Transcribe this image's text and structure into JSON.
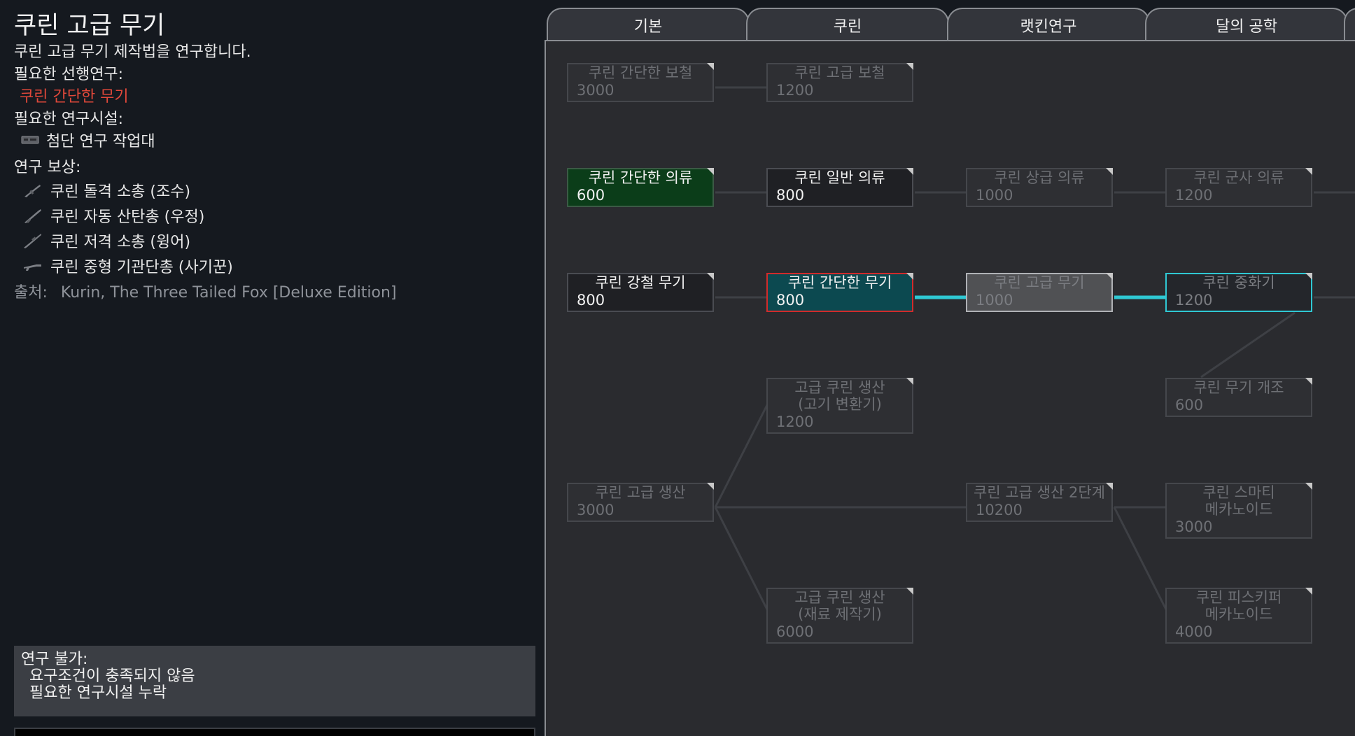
{
  "left_panel": {
    "title": "쿠린 고급 무기",
    "description": "쿠린 고급 무기 제작법을 연구합니다.",
    "prerequisites_label": "필요한 선행연구:",
    "prerequisite": "쿠린 간단한 무기",
    "bench_label": "필요한 연구시설:",
    "bench": "첨단 연구 작업대",
    "rewards_label": "연구 보상:",
    "rewards": [
      {
        "name": "쿠린 돌격 소총 (조수)",
        "icon": "rifle-icon"
      },
      {
        "name": "쿠린 자동 산탄총 (우정)",
        "icon": "shotgun-icon"
      },
      {
        "name": "쿠린 저격 소총 (윙어)",
        "icon": "sniper-icon"
      },
      {
        "name": "쿠린 중형 기관단총 (사기꾼)",
        "icon": "smg-icon"
      }
    ],
    "source_label": "출처:",
    "source": "Kurin, The Three Tailed Fox [Deluxe Edition]",
    "status": {
      "title": "연구 불가:",
      "lines": [
        "요구조건이 충족되지 않음",
        "필요한 연구시설 누락"
      ]
    }
  },
  "tabs": [
    {
      "label": "기본"
    },
    {
      "label": "쿠린"
    },
    {
      "label": "랫킨연구"
    },
    {
      "label": "달의 공학"
    }
  ],
  "colors": {
    "locked_text": "#6e7075",
    "finished_bg": "#0b3d19",
    "current_bg": "#0c4950",
    "current_border": "#d12b2b",
    "link_cyan": "#2fc8d3",
    "prereq_red": "#e0483a"
  },
  "nodes": [
    {
      "id": "simple-armor",
      "label": "쿠린 간단한 보철",
      "cost": "3000",
      "state": "locked"
    },
    {
      "id": "advanced-armor",
      "label": "쿠린 고급 보철",
      "cost": "1200",
      "state": "locked"
    },
    {
      "id": "simple-clothing",
      "label": "쿠린 간단한 의류",
      "cost": "600",
      "state": "finished"
    },
    {
      "id": "normal-clothing",
      "label": "쿠린 일반 의류",
      "cost": "800",
      "state": "available"
    },
    {
      "id": "upper-clothing",
      "label": "쿠린 상급 의류",
      "cost": "1000",
      "state": "locked"
    },
    {
      "id": "military-clothing",
      "label": "쿠린 군사 의류",
      "cost": "1200",
      "state": "locked"
    },
    {
      "id": "steel-weapon",
      "label": "쿠린 강철 무기",
      "cost": "800",
      "state": "available"
    },
    {
      "id": "simple-weapon",
      "label": "쿠린 간단한 무기",
      "cost": "800",
      "state": "current"
    },
    {
      "id": "advanced-weapon",
      "label": "쿠린 고급 무기",
      "cost": "1000",
      "state": "selected"
    },
    {
      "id": "heavy-weapon",
      "label": "쿠린 중화기",
      "cost": "1200",
      "state": "next"
    },
    {
      "id": "meat-converter",
      "label": "고급 쿠린 생산\n(고기 변환기)",
      "cost": "1200",
      "state": "locked"
    },
    {
      "id": "weapon-mod",
      "label": "쿠린 무기 개조",
      "cost": "600",
      "state": "locked"
    },
    {
      "id": "adv-production",
      "label": "쿠린 고급 생산",
      "cost": "3000",
      "state": "locked"
    },
    {
      "id": "adv-production-2",
      "label": "쿠린 고급 생산 2단계",
      "cost": "10200",
      "state": "locked"
    },
    {
      "id": "smarty-mechanoid",
      "label": "쿠린 스마티\n메카노이드",
      "cost": "3000",
      "state": "locked"
    },
    {
      "id": "material-fabricator",
      "label": "고급 쿠린 생산\n(재료 제작기)",
      "cost": "6000",
      "state": "locked"
    },
    {
      "id": "fishkeeper-mechanoid",
      "label": "쿠린 피스키퍼\n메카노이드",
      "cost": "4000",
      "state": "locked"
    }
  ]
}
